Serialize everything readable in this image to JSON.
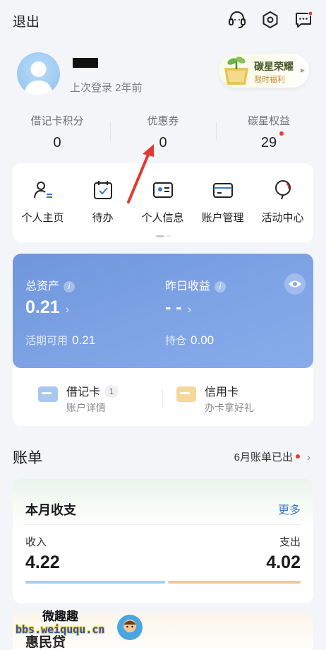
{
  "header": {
    "logout_label": "退出",
    "icons": [
      "headset-icon",
      "settings-icon",
      "message-icon"
    ]
  },
  "profile": {
    "last_login": "上次登录 2年前",
    "badge_title": "碳星荣耀",
    "badge_subtitle": "限时福利"
  },
  "stats": [
    {
      "label": "借记卡积分",
      "value": "0"
    },
    {
      "label": "优惠券",
      "value": "0"
    },
    {
      "label": "碳星权益",
      "value": "29"
    }
  ],
  "quick_actions": [
    {
      "label": "个人主页",
      "icon": "person-list-icon"
    },
    {
      "label": "待办",
      "icon": "calendar-check-icon"
    },
    {
      "label": "个人信息",
      "icon": "id-card-icon"
    },
    {
      "label": "账户管理",
      "icon": "card-icon"
    },
    {
      "label": "活动中心",
      "icon": "balloon-icon"
    }
  ],
  "assets": {
    "total_label": "总资产",
    "total_value": "0.21",
    "yesterday_label": "昨日收益",
    "yesterday_value": "- -",
    "available_label": "活期可用",
    "available_value": "0.21",
    "holding_label": "持仓",
    "holding_value": "0.00",
    "info_glyph": "i"
  },
  "cards": {
    "debit_title": "借记卡",
    "debit_count": "1",
    "debit_sub": "账户详情",
    "credit_title": "信用卡",
    "credit_sub": "办卡拿好礼"
  },
  "bill": {
    "title": "账单",
    "notice": "6月账单已出"
  },
  "monthly": {
    "title": "本月收支",
    "more": "更多",
    "income_label": "收入",
    "income_value": "4.22",
    "expense_label": "支出",
    "expense_value": "4.02",
    "income_share": 0.512,
    "income_color": "#a9cfe9",
    "expense_color": "#e8c9a2"
  },
  "next_section": {
    "title": "惠民贷"
  },
  "watermark": {
    "title": "微趣趣",
    "url": "bbs.weiququ.cn"
  },
  "colors": {
    "accent_red": "#e23b3b",
    "asset_card_blue": "#7ea4e6",
    "link_blue": "#3d77c8"
  }
}
